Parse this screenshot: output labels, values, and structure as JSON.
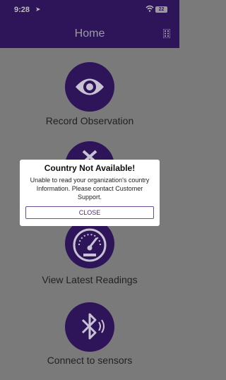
{
  "status_bar": {
    "time": "9:28",
    "location_icon": "location-arrow-icon",
    "wifi_icon": "wifi-icon",
    "battery": "22"
  },
  "nav": {
    "title": "Home",
    "right_icon": "building-grid-icon"
  },
  "menu": {
    "items": [
      {
        "label": "Record Observation",
        "icon": "eye-icon"
      },
      {
        "label": "",
        "icon": "tools-icon"
      },
      {
        "label": "View Latest Readings",
        "icon": "gauge-icon"
      },
      {
        "label": "Connect to sensors",
        "icon": "bluetooth-icon"
      }
    ]
  },
  "dialog": {
    "title": "Country Not Available!",
    "message": "Unable to read your organization's country Information. Please contact Customer Support.",
    "close_label": "CLOSE"
  },
  "colors": {
    "brand": "#2e1459",
    "overlay_background": "#7a7a7a",
    "button_border": "#6b4d95"
  }
}
